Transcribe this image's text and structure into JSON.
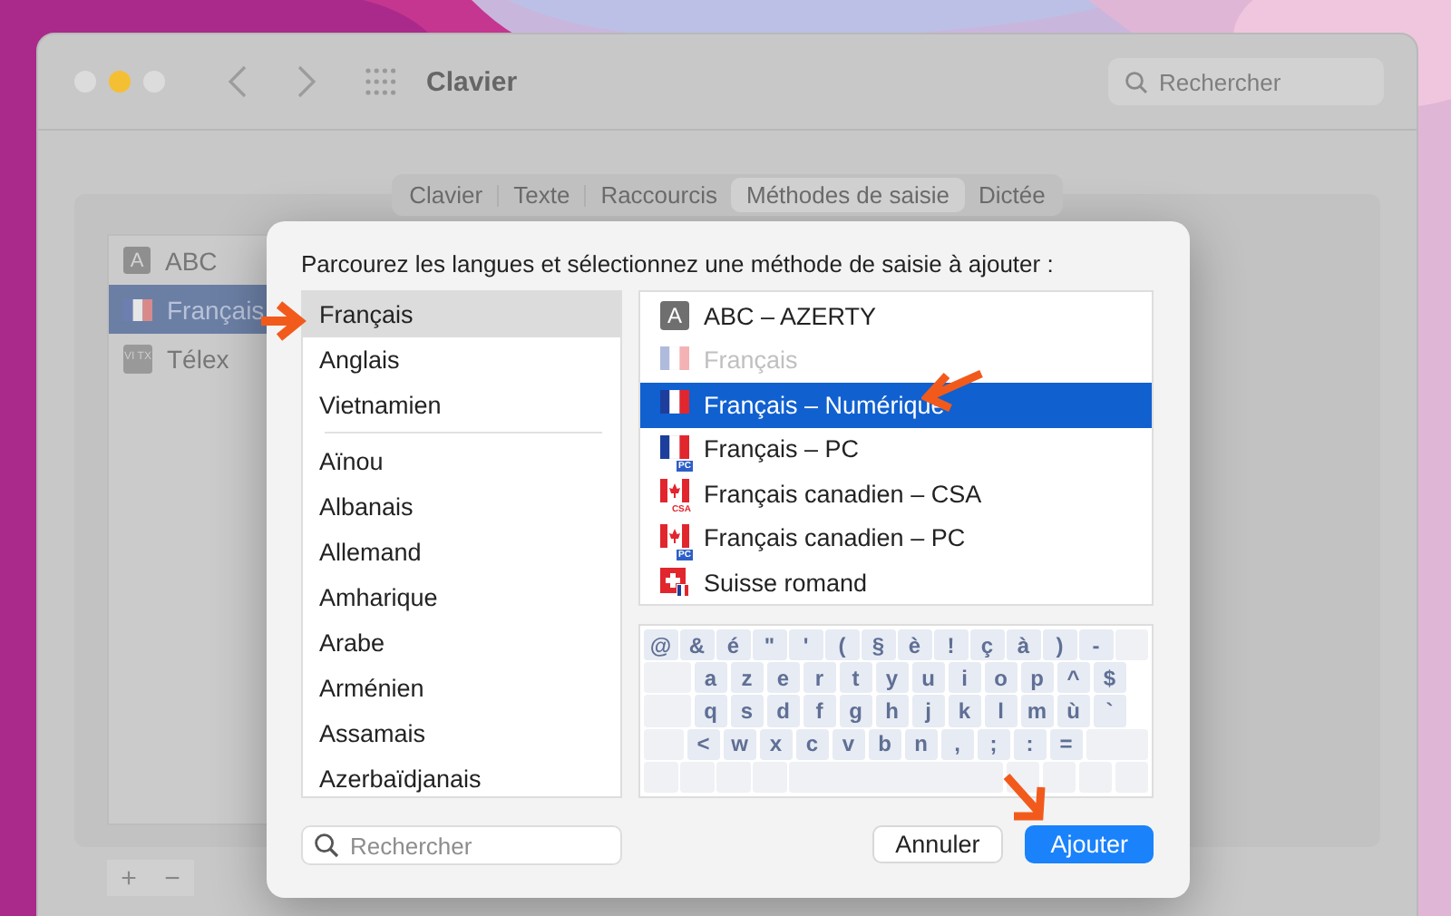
{
  "window": {
    "title": "Clavier",
    "search": {
      "placeholder": "Rechercher"
    }
  },
  "tabs": [
    {
      "label": "Clavier",
      "selected": false
    },
    {
      "label": "Texte",
      "selected": false
    },
    {
      "label": "Raccourcis",
      "selected": false
    },
    {
      "label": "Méthodes de saisie",
      "selected": true
    },
    {
      "label": "Dictée",
      "selected": false
    }
  ],
  "sources": [
    {
      "label": "ABC",
      "kind": "letter",
      "badge": "A",
      "selected": false
    },
    {
      "label": "Français",
      "kind": "flag-fr",
      "selected": true
    },
    {
      "label": "Télex",
      "kind": "vi",
      "badge": "VI TX",
      "selected": false
    }
  ],
  "sheet": {
    "prompt": "Parcourez les langues et sélectionnez une méthode de saisie à ajouter :",
    "languages_top": [
      {
        "label": "Français",
        "selected": true
      },
      {
        "label": "Anglais",
        "selected": false
      },
      {
        "label": "Vietnamien",
        "selected": false
      }
    ],
    "languages": [
      {
        "label": "Aïnou",
        "selected": false
      },
      {
        "label": "Albanais",
        "selected": false
      },
      {
        "label": "Allemand",
        "selected": false
      },
      {
        "label": "Amharique",
        "selected": false
      },
      {
        "label": "Arabe",
        "selected": false
      },
      {
        "label": "Arménien",
        "selected": false
      },
      {
        "label": "Assamais",
        "selected": false
      },
      {
        "label": "Azerbaïdjanais",
        "selected": false
      }
    ],
    "methods": [
      {
        "label": "ABC – AZERTY",
        "kind": "letter",
        "badge": "A",
        "disabled": false,
        "selected": false
      },
      {
        "label": "Français",
        "kind": "flag-fr",
        "disabled": true,
        "selected": false
      },
      {
        "label": "Français – Numérique",
        "kind": "flag-fr",
        "disabled": false,
        "selected": true
      },
      {
        "label": "Français – PC",
        "kind": "flag-fr",
        "badge": "PC",
        "disabled": false,
        "selected": false
      },
      {
        "label": "Français canadien – CSA",
        "kind": "flag-ca",
        "badge": "CSA",
        "disabled": false,
        "selected": false
      },
      {
        "label": "Français canadien – PC",
        "kind": "flag-ca",
        "badge": "PC",
        "disabled": false,
        "selected": false
      },
      {
        "label": "Suisse romand",
        "kind": "flag-ch",
        "disabled": false,
        "selected": false
      }
    ],
    "keyboard": {
      "rows": [
        [
          "@",
          "&",
          "é",
          "\"",
          "'",
          "(",
          "§",
          "è",
          "!",
          "ç",
          "à",
          ")",
          "-"
        ],
        [
          "a",
          "z",
          "e",
          "r",
          "t",
          "y",
          "u",
          "i",
          "o",
          "p",
          "^",
          "$"
        ],
        [
          "q",
          "s",
          "d",
          "f",
          "g",
          "h",
          "j",
          "k",
          "l",
          "m",
          "ù",
          "`"
        ],
        [
          "<",
          "w",
          "x",
          "c",
          "v",
          "b",
          "n",
          ",",
          ";",
          ":",
          "="
        ]
      ]
    },
    "search": {
      "placeholder": "Rechercher"
    },
    "buttons": [
      {
        "label": "Annuler",
        "kind": "cancel"
      },
      {
        "label": "Ajouter",
        "kind": "default"
      }
    ]
  },
  "footer_buttons": [
    "+",
    "−"
  ]
}
